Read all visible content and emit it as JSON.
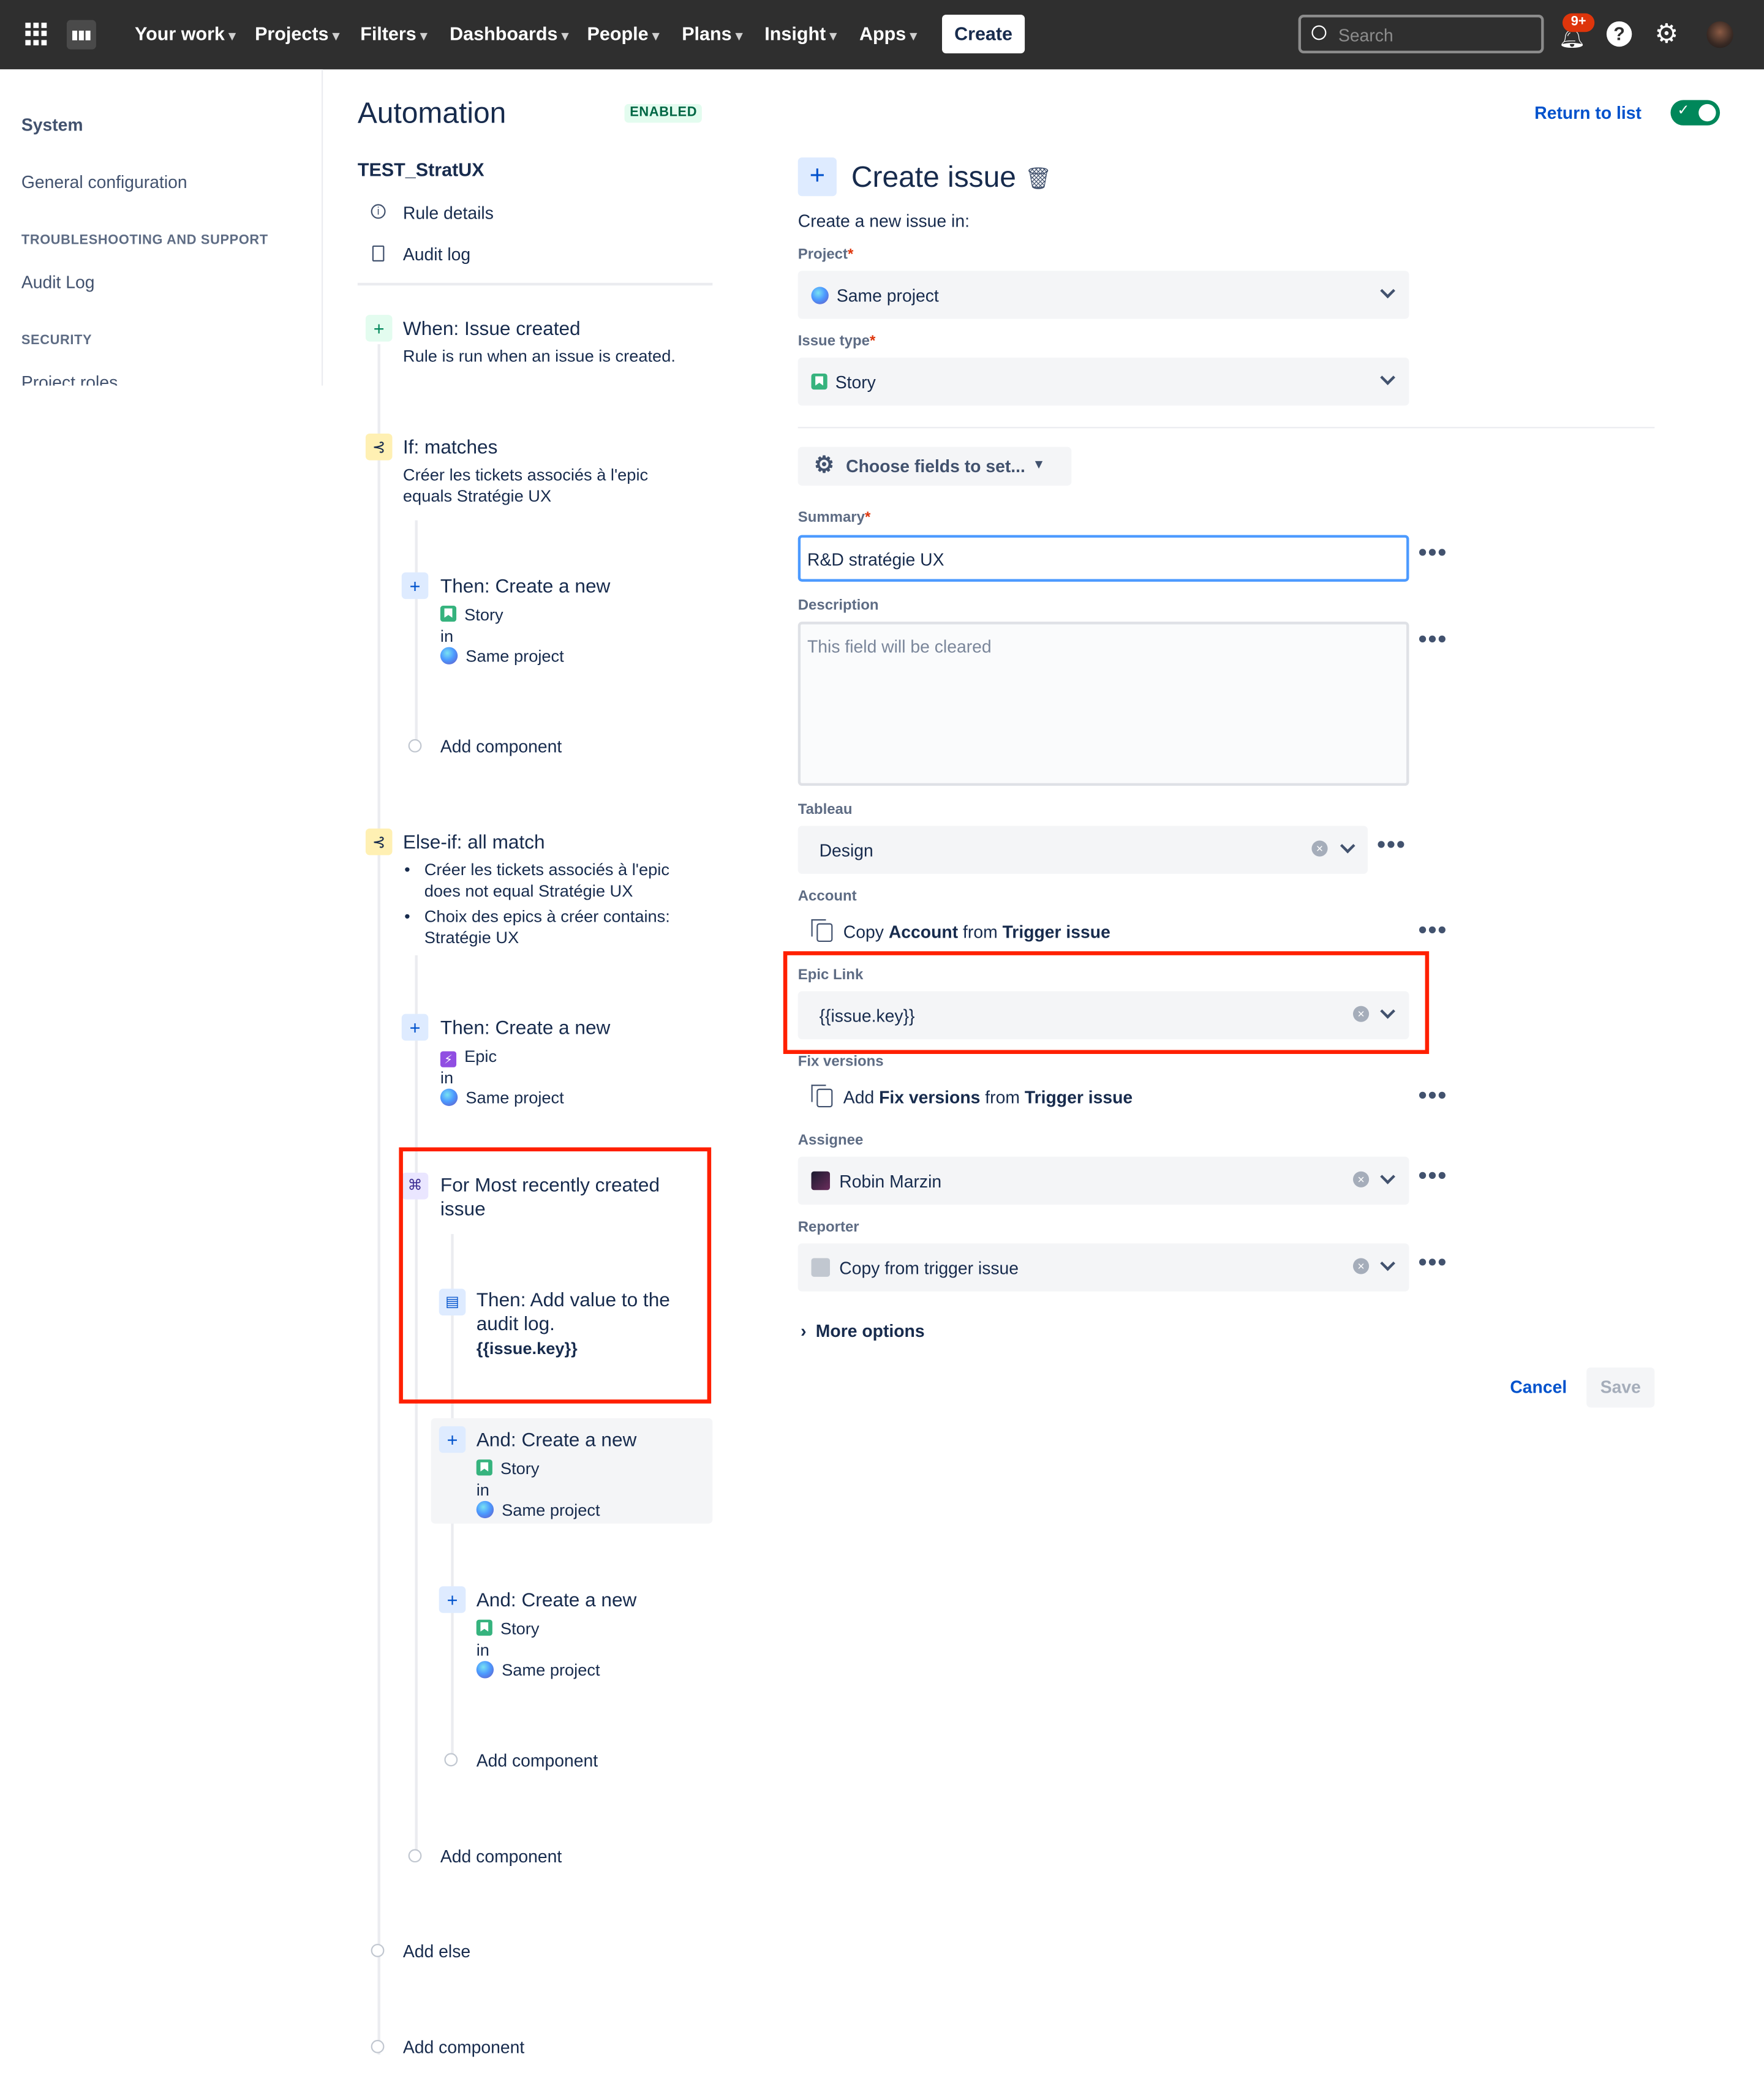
{
  "nav": {
    "items": [
      "Your work",
      "Projects",
      "Filters",
      "Dashboards",
      "People",
      "Plans",
      "Insight",
      "Apps"
    ],
    "create": "Create",
    "search_placeholder": "Search",
    "notifications_badge": "9+"
  },
  "sidebar": {
    "heading": "System",
    "general": "General configuration",
    "section_troubleshooting": "TROUBLESHOOTING AND SUPPORT",
    "audit_log": "Audit Log",
    "section_security": "SECURITY",
    "project_roles": "Project roles"
  },
  "rule": {
    "page_title": "Automation",
    "status": "ENABLED",
    "name": "TEST_StratUX",
    "rule_details": "Rule details",
    "audit_log": "Audit log",
    "trigger_title": "When: Issue created",
    "trigger_sub": "Rule is run when an issue is created.",
    "if_title": "If: matches",
    "if_sub1": "Créer les tickets associés à l'epic",
    "if_sub2": "equals Stratégie UX",
    "then1_title": "Then: Create a new",
    "then1_type": "Story",
    "in_label": "in",
    "project": "Same project",
    "add_component": "Add component",
    "elseif_title": "Else-if: all match",
    "elseif_b1a": "Créer les tickets associés à l'epic",
    "elseif_b1b": "does not equal Stratégie UX",
    "elseif_b2a": "Choix des epics à créer contains:",
    "elseif_b2b": "Stratégie UX",
    "then2_title": "Then: Create a new",
    "then2_type": "Epic",
    "branch_title1": "For Most recently created",
    "branch_title2": "issue",
    "log_title1": "Then: Add value to the",
    "log_title2": "audit log.",
    "log_value": "{{issue.key}}",
    "and_title": "And: Create a new",
    "story": "Story",
    "add_else": "Add else"
  },
  "form": {
    "return_link": "Return to list",
    "title": "Create issue",
    "subtitle": "Create a new issue in:",
    "project_label": "Project",
    "project_value": "Same project",
    "issue_type_label": "Issue type",
    "issue_type_value": "Story",
    "choose_fields": "Choose fields to set...",
    "summary_label": "Summary",
    "summary_value": "R&D stratégie UX",
    "description_label": "Description",
    "description_placeholder": "This field will be cleared",
    "tableau_label": "Tableau",
    "tableau_value": "Design",
    "account_label": "Account",
    "account_copy_pre": "Copy",
    "account_field": "Account",
    "account_from": "from",
    "account_src": "Trigger issue",
    "epic_label": "Epic Link",
    "epic_value": "{{issue.key}}",
    "fix_label": "Fix versions",
    "fix_pre": "Add",
    "fix_field": "Fix versions",
    "fix_from": "from",
    "fix_src": "Trigger issue",
    "assignee_label": "Assignee",
    "assignee_value": "Robin Marzin",
    "reporter_label": "Reporter",
    "reporter_value": "Copy from trigger issue",
    "more_options": "More options",
    "cancel": "Cancel",
    "save": "Save"
  },
  "colors": {
    "highlight": "#ff1f00",
    "brand_link": "#0052cc",
    "toggle_on": "#00875a"
  }
}
